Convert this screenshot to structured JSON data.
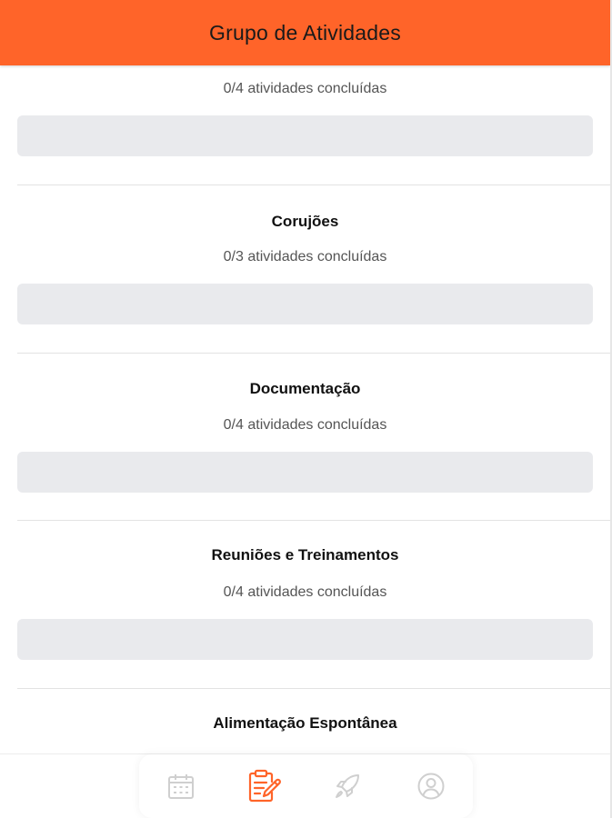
{
  "header": {
    "title": "Grupo de Atividades"
  },
  "groups": [
    {
      "title": "",
      "count_text": "0/4 atividades concluídas",
      "progress": 0
    },
    {
      "title": "Corujões",
      "count_text": "0/3 atividades concluídas",
      "progress": 0
    },
    {
      "title": "Documentação",
      "count_text": "0/4 atividades concluídas",
      "progress": 0
    },
    {
      "title": "Reuniões e Treinamentos",
      "count_text": "0/4 atividades concluídas",
      "progress": 0
    },
    {
      "title": "Alimentação Espontânea"
    }
  ],
  "bottom_nav": {
    "items": [
      {
        "icon": "calendar-icon",
        "active": false
      },
      {
        "icon": "clipboard-edit-icon",
        "active": true
      },
      {
        "icon": "rocket-icon",
        "active": false
      },
      {
        "icon": "user-profile-icon",
        "active": false
      }
    ]
  },
  "colors": {
    "accent": "#ff6429",
    "track": "#e9eaed",
    "inactive_icon": "#cfcfcf"
  }
}
